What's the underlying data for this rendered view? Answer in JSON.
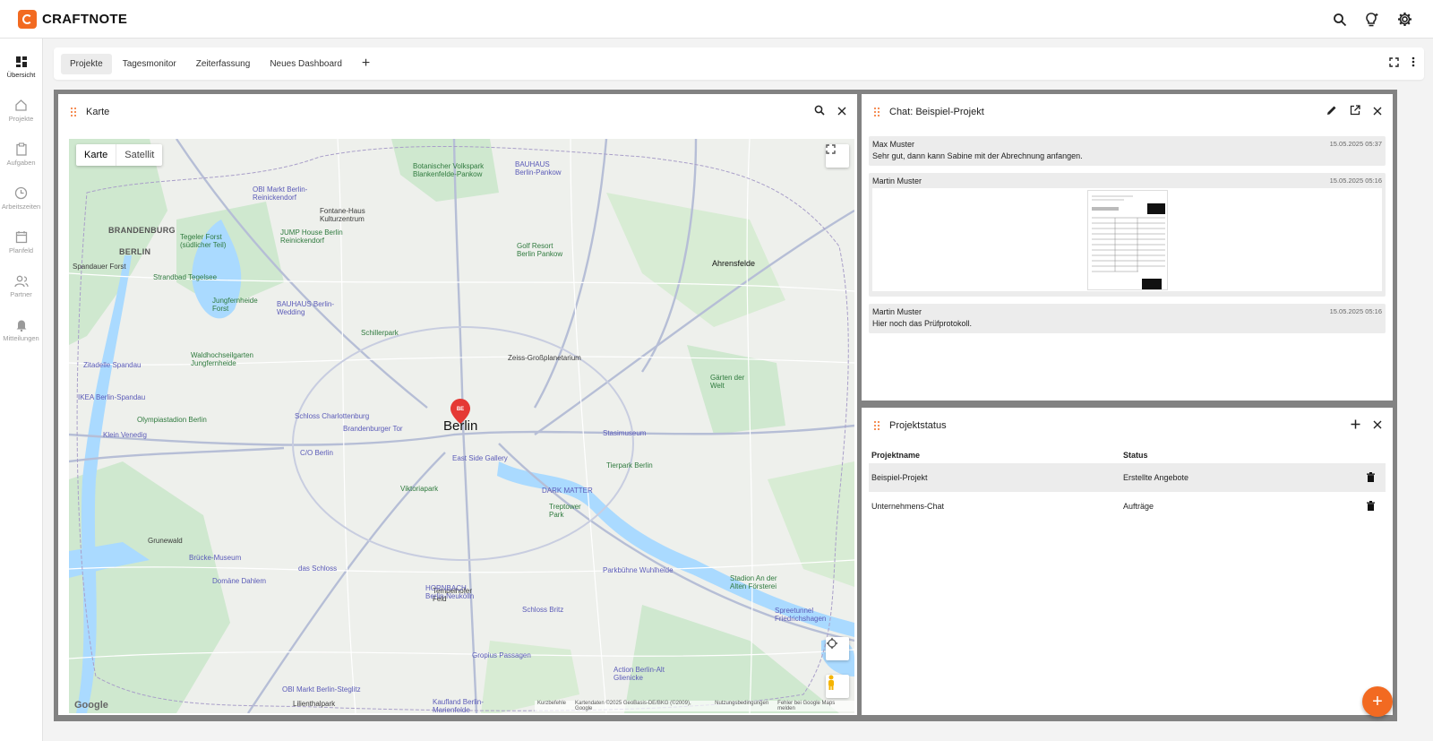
{
  "app": {
    "name": "CRAFTNOTE"
  },
  "topbar": {
    "icons": [
      "search-icon",
      "lightbulb-icon",
      "gear-icon"
    ]
  },
  "sidebar": {
    "items": [
      {
        "label": "Übersicht",
        "icon": "dashboard-icon",
        "active": true
      },
      {
        "label": "Projekte",
        "icon": "home-icon"
      },
      {
        "label": "Aufgaben",
        "icon": "clipboard-icon"
      },
      {
        "label": "Arbeitszeiten",
        "icon": "clock-icon"
      },
      {
        "label": "Planfeld",
        "icon": "calendar-icon"
      },
      {
        "label": "Partner",
        "icon": "people-icon"
      },
      {
        "label": "Mitteilungen",
        "icon": "bell-icon"
      }
    ]
  },
  "tabs": [
    {
      "label": "Projekte",
      "active": true
    },
    {
      "label": "Tagesmonitor"
    },
    {
      "label": "Zeiterfassung"
    },
    {
      "label": "Neues Dashboard"
    }
  ],
  "tab_add": "+",
  "map_panel": {
    "title": "Karte",
    "type_buttons": [
      "Karte",
      "Satellit"
    ],
    "city": "Berlin",
    "marker": "BE",
    "labels": [
      {
        "text": "BRANDENBURG",
        "cls": "big"
      },
      {
        "text": "BERLIN",
        "cls": "big"
      },
      {
        "text": "Spandauer Forst",
        "cls": ""
      },
      {
        "text": "Tegeler Forst (südlicher Teil)",
        "cls": "green"
      },
      {
        "text": "OBI Markt Berlin-Reinickendorf",
        "cls": "poi"
      },
      {
        "text": "Botanischer Volkspark Blankenfelde-Pankow",
        "cls": "green"
      },
      {
        "text": "BAUHAUS Berlin-Pankow",
        "cls": "poi"
      },
      {
        "text": "Fontane-Haus Kulturzentrum",
        "cls": ""
      },
      {
        "text": "JUMP House Berlin Reinickendorf",
        "cls": "green"
      },
      {
        "text": "Golf Resort Berlin Pankow",
        "cls": "green"
      },
      {
        "text": "Strandbad Tegelsee",
        "cls": "green"
      },
      {
        "text": "Jungfernheide Forst",
        "cls": "green"
      },
      {
        "text": "BAUHAUS Berlin-Wedding",
        "cls": "poi"
      },
      {
        "text": "Ahrensfelde",
        "cls": ""
      },
      {
        "text": "Schillerpark",
        "cls": "green"
      },
      {
        "text": "Zeiss-Großplanetarium",
        "cls": ""
      },
      {
        "text": "Zitadelle Spandau",
        "cls": "poi"
      },
      {
        "text": "Waldhochseilgarten Jungfernheide",
        "cls": "green"
      },
      {
        "text": "IKEA Berlin-Spandau",
        "cls": "poi"
      },
      {
        "text": "Gärten der Welt",
        "cls": "green"
      },
      {
        "text": "Olympiastadion Berlin",
        "cls": "green"
      },
      {
        "text": "Schloss Charlottenburg",
        "cls": "poi"
      },
      {
        "text": "Brandenburger Tor",
        "cls": "poi"
      },
      {
        "text": "Stasimuseum",
        "cls": "poi"
      },
      {
        "text": "Klein Venedig",
        "cls": "poi"
      },
      {
        "text": "C/O Berlin",
        "cls": "poi"
      },
      {
        "text": "East Side Gallery",
        "cls": "poi"
      },
      {
        "text": "Tierpark Berlin",
        "cls": "green"
      },
      {
        "text": "Viktoriapark",
        "cls": "green"
      },
      {
        "text": "DARK MATTER",
        "cls": "poi"
      },
      {
        "text": "Treptower Park",
        "cls": "green"
      },
      {
        "text": "Grunewald",
        "cls": ""
      },
      {
        "text": "Tempelhofer Feld",
        "cls": ""
      },
      {
        "text": "Brücke-Museum",
        "cls": "poi"
      },
      {
        "text": "das Schloss",
        "cls": "poi"
      },
      {
        "text": "Domäne Dahlem",
        "cls": "poi"
      },
      {
        "text": "Parkbühne Wuhlheide",
        "cls": "poi"
      },
      {
        "text": "Stadion An der Alten Försterei",
        "cls": "green"
      },
      {
        "text": "HORNBACH Berlin-Neukölln",
        "cls": "poi"
      },
      {
        "text": "Schloss Britz",
        "cls": "poi"
      },
      {
        "text": "Gropius Passagen",
        "cls": "poi"
      },
      {
        "text": "Spreetunnel Friedrichshagen",
        "cls": "poi"
      },
      {
        "text": "Action Berlin-Alt Glienicke",
        "cls": "poi"
      },
      {
        "text": "OBI Markt Berlin-Steglitz",
        "cls": "poi"
      },
      {
        "text": "Kaufland Berlin-Marienfelde",
        "cls": "poi"
      },
      {
        "text": "Lilienthalpark",
        "cls": ""
      }
    ],
    "footer": [
      "Kurzbefehle",
      "Kartendaten ©2025 GeoBasis-DE/BKG (©2009), Google",
      "Nutzungsbedingungen",
      "Fehler bei Google Maps melden"
    ],
    "google": "Google"
  },
  "chat_panel": {
    "title": "Chat: Beispiel-Projekt",
    "messages": [
      {
        "author": "Max Muster",
        "time": "15.05.2025 05:37",
        "text": "Sehr gut, dann kann Sabine mit der Abrechnung anfangen."
      },
      {
        "author": "Martin Muster",
        "time": "15.05.2025 05:16",
        "text": "",
        "attachment": "document-image"
      },
      {
        "author": "Martin Muster",
        "time": "15.05.2025 05:16",
        "text": "Hier noch das Prüfprotokoll."
      }
    ]
  },
  "status_panel": {
    "title": "Projektstatus",
    "columns": [
      "Projektname",
      "Status"
    ],
    "rows": [
      {
        "name": "Beispiel-Projekt",
        "status": "Erstellte Angebote"
      },
      {
        "name": "Unternehmens-Chat",
        "status": "Aufträge"
      }
    ]
  },
  "fab": {
    "label": "+"
  },
  "colors": {
    "accent": "#f26a21",
    "dash_bg": "#828282"
  }
}
